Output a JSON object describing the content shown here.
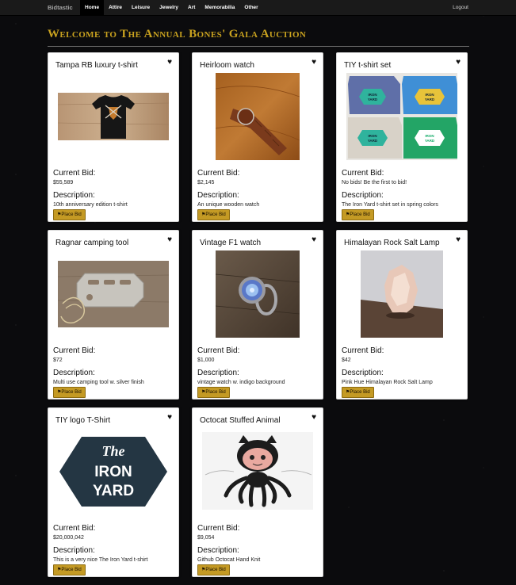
{
  "navbar": {
    "brand": "Bidtastic",
    "items": [
      {
        "label": "Home"
      },
      {
        "label": "Attire"
      },
      {
        "label": "Leisure"
      },
      {
        "label": "Jewelry"
      },
      {
        "label": "Art"
      },
      {
        "label": "Memorabilia"
      },
      {
        "label": "Other"
      }
    ],
    "logout": "Logout"
  },
  "page": {
    "title": "Welcome to The Annual Bones' Gala Auction"
  },
  "labels": {
    "current_bid": "Current Bid:",
    "description": "Description:",
    "place_bid": "Place Bid"
  },
  "items": [
    {
      "title": "Tampa RB luxury t-shirt",
      "current_bid": "$55,589",
      "description": "10th anniversary edition t-shirt",
      "image": "black-tshirt-photo"
    },
    {
      "title": "Heirloom watch",
      "current_bid": "$2,145",
      "description": "An unique wooden watch",
      "image": "wooden-watch-photo"
    },
    {
      "title": "TIY t-shirt set",
      "current_bid": "No bids! Be the first to bid!",
      "description": "The Iron Yard t-shirt set in spring colors",
      "image": "iron-yard-shirts-photo",
      "shirt_logo": [
        "THE",
        "IRON",
        "YARD"
      ]
    },
    {
      "title": "Ragnar camping tool",
      "current_bid": "$72",
      "description": "Multi use camping tool w. silver finish",
      "image": "camping-tool-photo"
    },
    {
      "title": "Vintage F1 watch",
      "current_bid": "$1,000",
      "description": "vintage watch w. indigo background",
      "image": "vintage-ring-watch-photo"
    },
    {
      "title": "Himalayan Rock Salt Lamp",
      "current_bid": "$42",
      "description": "Pink Hue Himalayan Rock Salt Lamp",
      "image": "salt-lamp-photo"
    },
    {
      "title": "TIY logo T-Shirt",
      "current_bid": "$20,000,042",
      "description": "This is a very nice The Iron Yard t-shirt",
      "image": "iron-yard-logo",
      "logo_lines": [
        "The",
        "IRON",
        "YARD"
      ]
    },
    {
      "title": "Octocat Stuffed Animal",
      "current_bid": "$9,054",
      "description": "Github Octocat Hand Knit",
      "image": "octocat-plush-photo"
    }
  ],
  "colors": {
    "accent_gold": "#c9a21f",
    "button_gold": "#c49a24",
    "navbar": "#1a1a1a",
    "background": "#0b0b0d",
    "card": "#ffffff"
  },
  "icons": {
    "favorite": "heart-icon",
    "bid_button": "gavel-icon"
  }
}
